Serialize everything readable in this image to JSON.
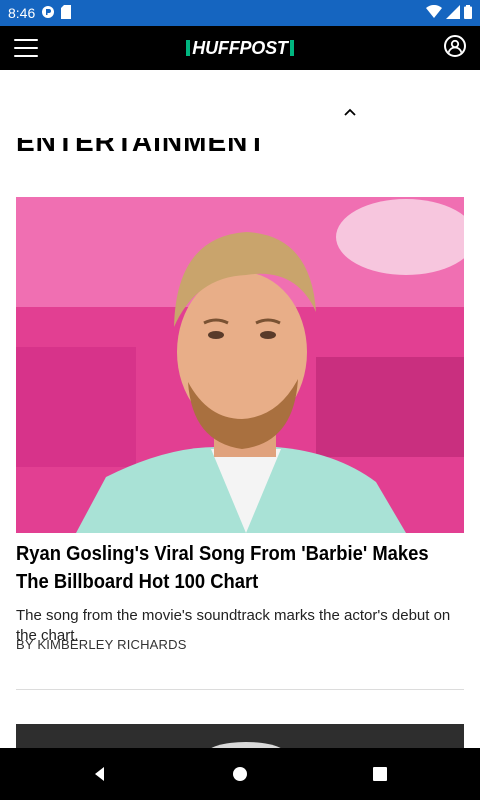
{
  "status_bar": {
    "time": "8:46",
    "icons": [
      "data-saver-icon",
      "sim-card-icon",
      "wifi-icon",
      "cell-signal-icon",
      "battery-icon"
    ]
  },
  "app_bar": {
    "brand": "HUFFPOST",
    "brand_color": "#00b57f",
    "menu_icon": "hamburger-menu-icon",
    "account_icon": "account-icon"
  },
  "section": {
    "title": "ENTERTAINMENT"
  },
  "article": {
    "headline": "Ryan Gosling's Viral Song From 'Barbie' Makes The Billboard Hot 100 Chart",
    "summary": "The song from the movie's soundtrack marks the actor's debut on the chart.",
    "byline": "BY KIMBERLEY RICHARDS",
    "image_background_color": "#e0398e"
  },
  "nav_bar": {
    "icons": [
      "back-icon",
      "home-icon",
      "recents-icon"
    ]
  }
}
